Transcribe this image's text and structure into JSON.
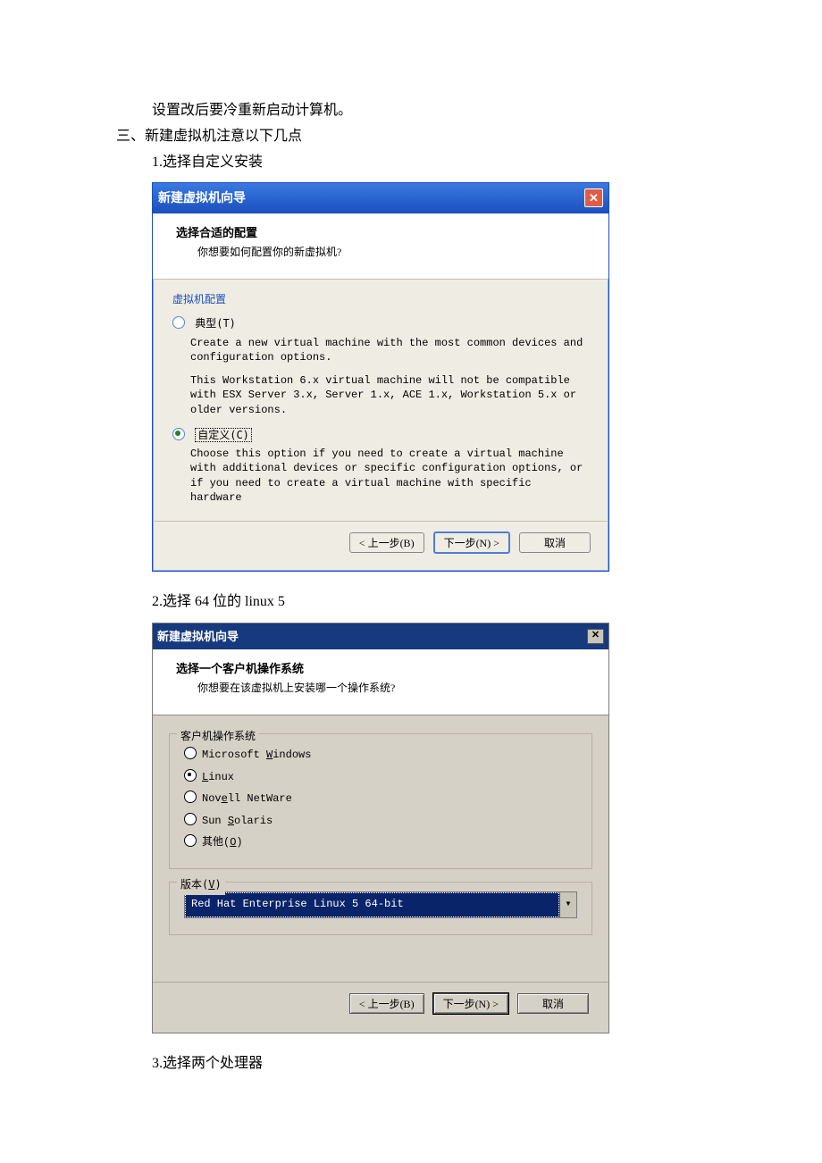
{
  "text": {
    "line1": "设置改后要冷重新启动计算机。",
    "line2": "三、新建虚拟机注意以下几点",
    "step1": "1.选择自定义安装",
    "step2": "2.选择 64 位的 linux 5",
    "step3": "3.选择两个处理器"
  },
  "dlg1": {
    "window_title": "新建虚拟机向导",
    "head_title": "选择合适的配置",
    "head_sub": "你想要如何配置你的新虚拟机?",
    "group_label": "虚拟机配置",
    "opt_typical": {
      "selected": false,
      "label": "典型(T)",
      "desc1": "Create a new virtual machine with the most common devices and configuration options.",
      "desc2": "This Workstation 6.x virtual machine will not be compatible with ESX Server 3.x, Server 1.x, ACE 1.x, Workstation 5.x or older versions."
    },
    "opt_custom": {
      "selected": true,
      "label": "自定义(C)",
      "desc": "Choose this option if you need to create a virtual machine with additional devices or specific configuration options, or if you need to create a virtual machine with specific hardware"
    },
    "buttons": {
      "back": "< 上一步(B)",
      "next": "下一步(N) >",
      "cancel": "取消"
    }
  },
  "dlg2": {
    "window_title": "新建虚拟机向导",
    "head_title": "选择一个客户机操作系统",
    "head_sub": "你想要在该虚拟机上安装哪一个操作系统?",
    "os_group_label": "客户机操作系统",
    "os_options": {
      "windows": {
        "selected": false,
        "label_pre": "Microsoft ",
        "u": "W",
        "label_post": "indows"
      },
      "linux": {
        "selected": true,
        "label_pre": "",
        "u": "L",
        "label_post": "inux"
      },
      "netware": {
        "selected": false,
        "label_pre": "Nov",
        "u": "e",
        "label_post": "ll NetWare"
      },
      "solaris": {
        "selected": false,
        "label_pre": "Sun ",
        "u": "S",
        "label_post": "olaris"
      },
      "other": {
        "selected": false,
        "label_pre": "其他(",
        "u": "O",
        "label_post": ")"
      }
    },
    "version_label_pre": "版本(",
    "version_label_u": "V",
    "version_label_post": ")",
    "version_selected": "Red Hat Enterprise Linux 5 64-bit",
    "buttons": {
      "back": "< 上一步(B)",
      "next": "下一步(N) >",
      "cancel": "取消"
    }
  }
}
